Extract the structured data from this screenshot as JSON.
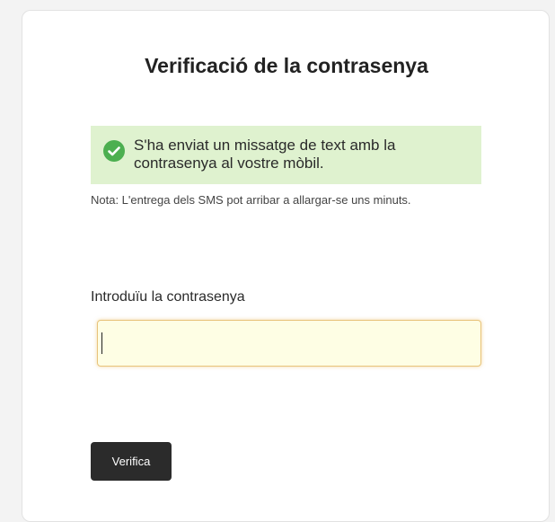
{
  "page": {
    "title": "Verificació de la contrasenya"
  },
  "alert": {
    "icon": "check-circle-icon",
    "color": "#4caf50",
    "background": "#dff2cf",
    "message": "S'ha enviat un missatge de text amb la contrasenya al vostre mòbil."
  },
  "note": "Nota: L'entrega dels SMS pot arribar a allargar-se uns minuts.",
  "form": {
    "password_label": "Introduïu la contrasenya",
    "password_value": "",
    "submit_label": "Verifica"
  }
}
